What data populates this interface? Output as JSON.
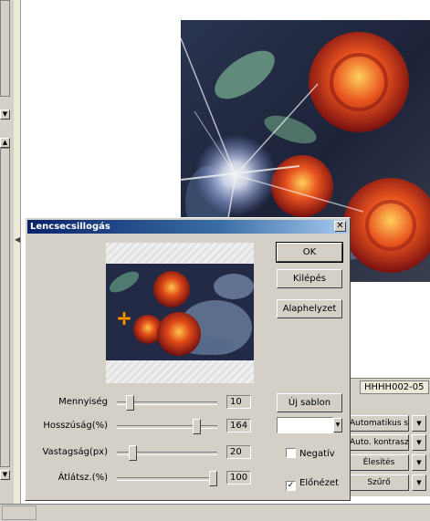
{
  "dialog": {
    "title": "Lencsecsillogás",
    "close_glyph": "✕",
    "buttons": {
      "ok": "OK",
      "exit": "Kilépés",
      "reset": "Alaphelyzet",
      "new_template": "Új sablon"
    },
    "sliders": [
      {
        "label": "Mennyiség",
        "value": "10",
        "fraction": 0.1
      },
      {
        "label": "Hosszúság(%)",
        "value": "164",
        "fraction": 0.82
      },
      {
        "label": "Vastagság(px)",
        "value": "20",
        "fraction": 0.13
      },
      {
        "label": "Átlátsz.(%)",
        "value": "100",
        "fraction": 1.0
      }
    ],
    "flare_color": "#ffffff",
    "negative": {
      "label": "Negatív",
      "checked": false
    },
    "preview": {
      "label": "Előnézet",
      "checked": true
    },
    "check_mark": "✓",
    "dropdown_glyph": "▼"
  },
  "background_app": {
    "status_text": "HHHH002-05",
    "tools": [
      {
        "label": "Automatikus szint"
      },
      {
        "label": "Auto. kontraszt"
      },
      {
        "label": "Élesítés"
      },
      {
        "label": "Szűrő"
      }
    ],
    "scroll_up_glyph": "▲",
    "scroll_down_glyph": "▼",
    "splitter_glyph": "◀"
  },
  "icons": {
    "flare-center": "orange-crosshair-icon"
  },
  "colors": {
    "title_bar_start": "#0a246a",
    "title_bar_end": "#a6caf0",
    "dialog_face": "#d4d0c8"
  }
}
